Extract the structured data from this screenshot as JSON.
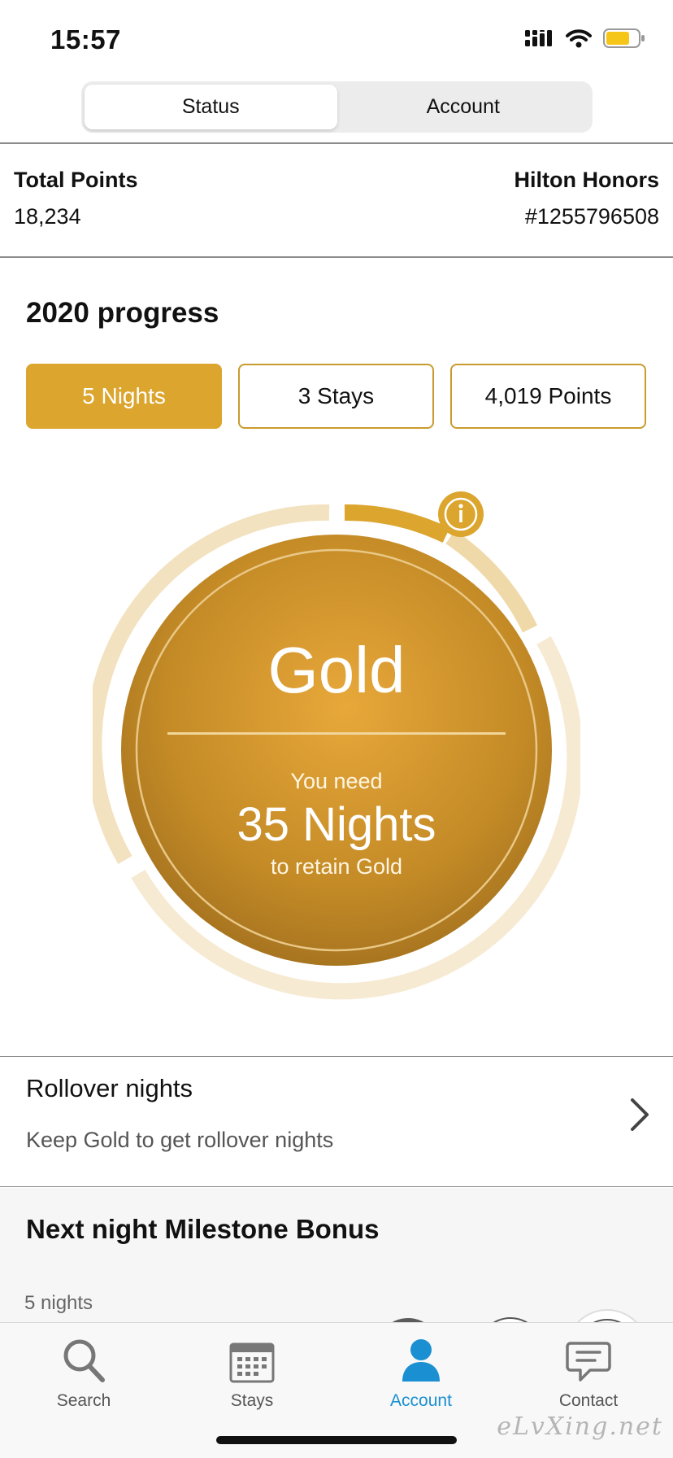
{
  "status_bar": {
    "time": "15:57"
  },
  "segmented": {
    "status_label": "Status",
    "account_label": "Account"
  },
  "points": {
    "total_label": "Total Points",
    "total_value": "18,234",
    "program_label": "Hilton Honors",
    "member_number": "#1255796508"
  },
  "progress": {
    "title": "2020 progress",
    "chips": [
      {
        "label": "5 Nights",
        "active": true
      },
      {
        "label": "3 Stays",
        "active": false
      },
      {
        "label": "4,019 Points",
        "active": false
      }
    ]
  },
  "tier_circle": {
    "tier": "Gold",
    "need_label": "You need",
    "nights_needed": "35 Nights",
    "retain_label": "to retain Gold",
    "info_icon": "info-icon",
    "colors": {
      "gold": "#dba52e",
      "ring_light": "#f3e2c0"
    }
  },
  "rollover": {
    "title": "Rollover nights",
    "subtitle": "Keep Gold to get rollover nights"
  },
  "milestone": {
    "title": "Next night Milestone Bonus",
    "subtitle": "5 nights"
  },
  "tabbar": {
    "items": [
      {
        "label": "Search",
        "icon": "search-icon"
      },
      {
        "label": "Stays",
        "icon": "calendar-icon"
      },
      {
        "label": "Account",
        "icon": "person-icon",
        "active": true
      },
      {
        "label": "Contact",
        "icon": "chat-icon"
      }
    ],
    "active_color": "#1a8fd1"
  },
  "watermark": "eLvXing.net"
}
